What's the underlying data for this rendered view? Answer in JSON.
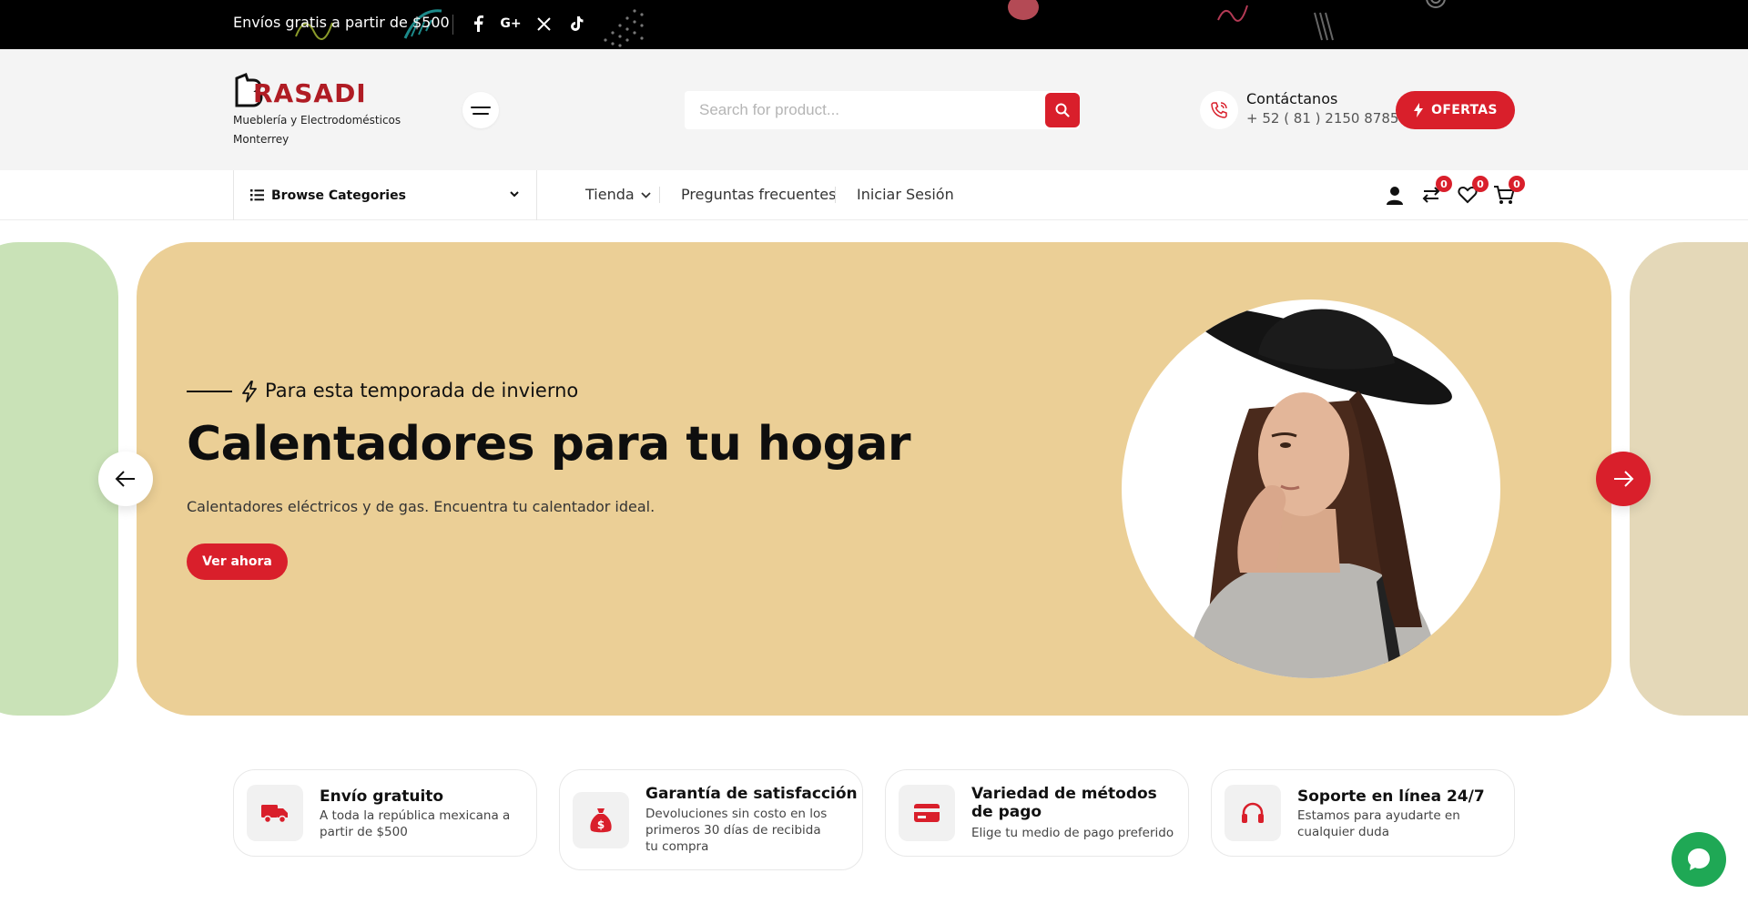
{
  "topbar": {
    "promo": " Envíos gratis a partir de $500",
    "social": [
      {
        "icon": "facebook-icon",
        "glyph": "f"
      },
      {
        "icon": "google-plus-icon",
        "glyph": "G+"
      },
      {
        "icon": "x-twitter-icon",
        "glyph": "𝕏"
      },
      {
        "icon": "tiktok-icon",
        "glyph": "♪"
      }
    ]
  },
  "header": {
    "logo_text": "BRASADI",
    "logo_subtitle": "Mueblería y Electrodomésticos Monterrey",
    "search_placeholder": "Search for product...",
    "contact_title": "Contáctanos",
    "contact_phone": "+ 52 ( 81 ) 2150 8785",
    "ofertas_label": "OFERTAS"
  },
  "nav": {
    "browse_label": "Browse Categories",
    "links": [
      "Tienda",
      "Preguntas frecuentes",
      "Iniciar Sesión"
    ],
    "compare_count": "0",
    "wishlist_count": "0",
    "cart_count": "0"
  },
  "hero": {
    "tag": "Para esta temporada de invierno",
    "title": "Calentadores para tu hogar",
    "subtitle": "Calentadores eléctricos y de gas. Encuentra tu calentador ideal.",
    "cta": "Ver ahora"
  },
  "features": [
    {
      "title": "Envío gratuito",
      "desc": "A toda la república mexicana a partir de $500",
      "icon": "truck-icon"
    },
    {
      "title": "Garantía de satisfacción",
      "desc": "Devoluciones sin costo en los primeros 30 días de recibida tu compra",
      "icon": "money-bag-icon"
    },
    {
      "title": "Variedad de métodos de pago",
      "desc": "Elige tu medio de pago preferido",
      "icon": "credit-card-icon"
    },
    {
      "title": "Soporte en línea 24/7",
      "desc": "Estamos para ayudarte en cualquier duda",
      "icon": "headphones-icon"
    }
  ],
  "colors": {
    "accent": "#d91f2b",
    "hero_bg": "#ebcf96",
    "chat": "#1fa855"
  }
}
